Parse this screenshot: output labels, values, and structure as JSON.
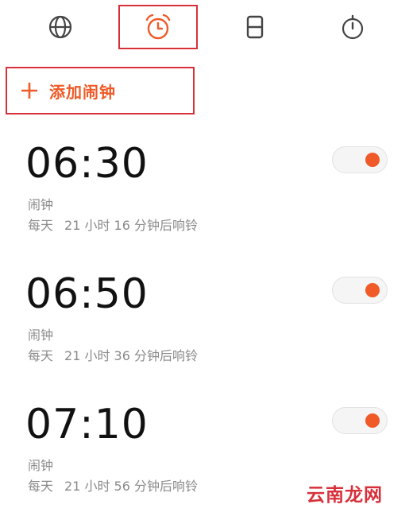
{
  "tabs": [
    {
      "icon": "globe-icon",
      "active": false
    },
    {
      "icon": "alarm-clock-icon",
      "active": true
    },
    {
      "icon": "hourglass-icon",
      "active": false
    },
    {
      "icon": "stopwatch-icon",
      "active": false
    }
  ],
  "add_alarm": {
    "label": "添加闹钟",
    "icon": "plus-icon"
  },
  "alarms": [
    {
      "time": "06:30",
      "name": "闹钟",
      "repeat": "每天",
      "countdown": "21 小时 16 分钟后响铃",
      "enabled": true
    },
    {
      "time": "06:50",
      "name": "闹钟",
      "repeat": "每天",
      "countdown": "21 小时 36 分钟后响铃",
      "enabled": true
    },
    {
      "time": "07:10",
      "name": "闹钟",
      "repeat": "每天",
      "countdown": "21 小时 56 分钟后响铃",
      "enabled": true
    }
  ],
  "watermark": "云南龙网",
  "colors": {
    "accent": "#ef5a28",
    "highlight_box": "#d8303b",
    "muted_text": "#8a8a8a"
  }
}
